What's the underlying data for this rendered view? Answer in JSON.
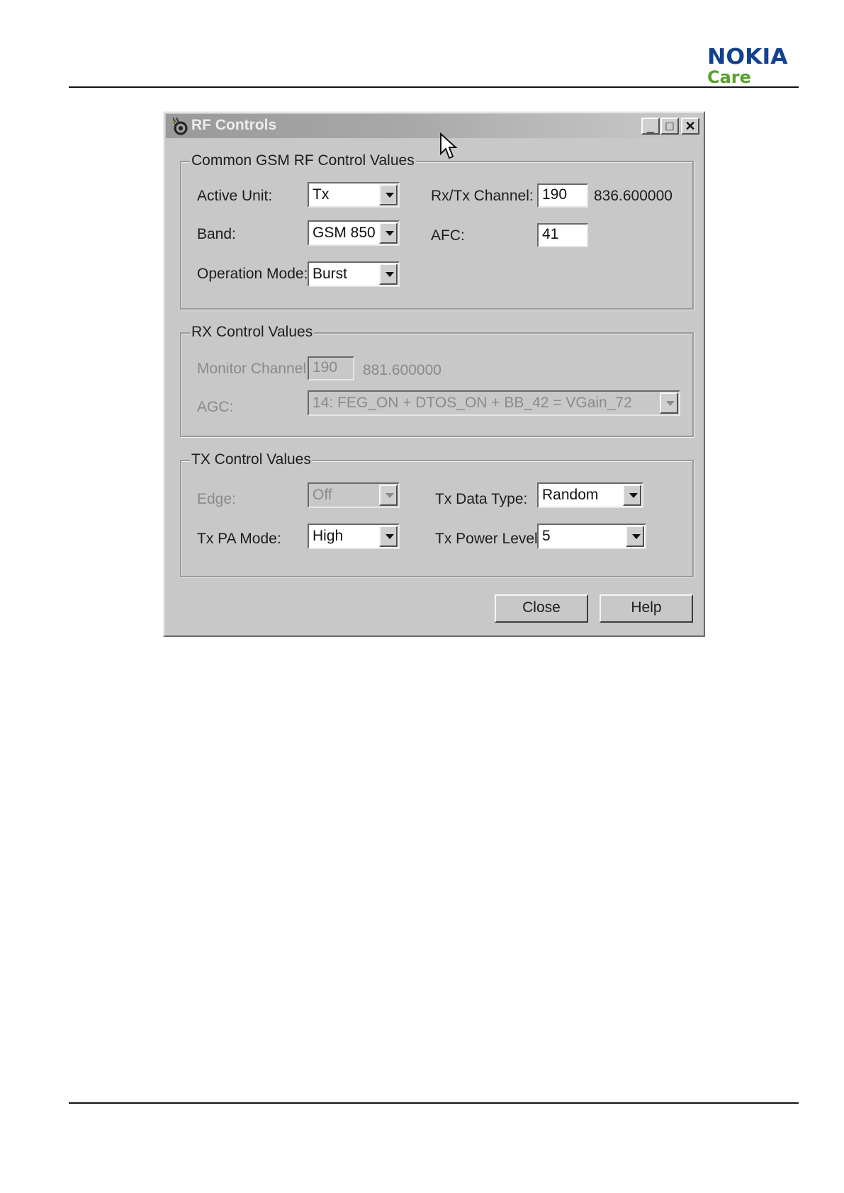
{
  "header": {
    "logo_brand": "NOKIA",
    "logo_sub": "Care"
  },
  "window": {
    "title": "RF Controls",
    "title_buttons": {
      "minimize": "_",
      "maximize": "□",
      "close": "✕"
    }
  },
  "common_group": {
    "legend": "Common GSM RF Control Values",
    "active_unit": {
      "label": "Active Unit:",
      "value": "Tx"
    },
    "band": {
      "label": "Band:",
      "value": "GSM 850"
    },
    "operation_mode": {
      "label": "Operation Mode:",
      "value": "Burst"
    },
    "rx_tx_channel": {
      "label": "Rx/Tx Channel:",
      "value": "190",
      "frequency": "836.600000"
    },
    "afc": {
      "label": "AFC:",
      "value": "41"
    }
  },
  "rx_group": {
    "legend": "RX Control Values",
    "monitor_channel": {
      "label": "Monitor Channel:",
      "value": "190",
      "frequency": "881.600000"
    },
    "agc": {
      "label": "AGC:",
      "value": "14: FEG_ON + DTOS_ON + BB_42 = VGain_72"
    }
  },
  "tx_group": {
    "legend": "TX Control Values",
    "edge": {
      "label": "Edge:",
      "value": "Off"
    },
    "tx_data_type": {
      "label": "Tx Data Type:",
      "value": "Random"
    },
    "tx_pa_mode": {
      "label": "Tx PA Mode:",
      "value": "High"
    },
    "tx_power_level": {
      "label": "Tx Power Level:",
      "value": "5"
    }
  },
  "buttons": {
    "close": "Close",
    "help": "Help"
  },
  "colors": {
    "nokia_blue": "#124191",
    "care_green": "#5aa02c",
    "dialog_gray": "#c8c8c8"
  }
}
